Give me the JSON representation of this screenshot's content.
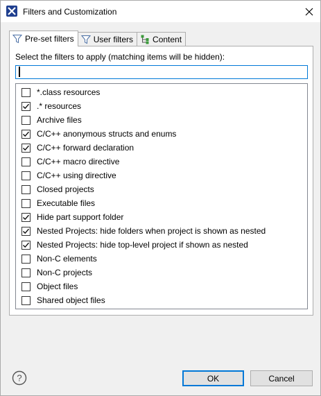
{
  "window": {
    "title": "Filters and Customization"
  },
  "tabs": [
    {
      "label": "Pre-set filters",
      "icon": "filter-icon",
      "active": true
    },
    {
      "label": "User filters",
      "icon": "filter-icon",
      "active": false
    },
    {
      "label": "Content",
      "icon": "tree-icon",
      "active": false
    }
  ],
  "panel": {
    "instruction": "Select the filters to apply (matching items will be hidden):",
    "filter_value": "",
    "items": [
      {
        "label": "*.class resources",
        "checked": false
      },
      {
        "label": ".* resources",
        "checked": true
      },
      {
        "label": "Archive files",
        "checked": false
      },
      {
        "label": "C/C++ anonymous structs and enums",
        "checked": true
      },
      {
        "label": "C/C++ forward declaration",
        "checked": true
      },
      {
        "label": "C/C++ macro directive",
        "checked": false
      },
      {
        "label": "C/C++ using directive",
        "checked": false
      },
      {
        "label": "Closed projects",
        "checked": false
      },
      {
        "label": "Executable files",
        "checked": false
      },
      {
        "label": "Hide part support folder",
        "checked": true
      },
      {
        "label": "Nested Projects: hide folders when project is shown as nested",
        "checked": true
      },
      {
        "label": "Nested Projects: hide top-level project if shown as nested",
        "checked": true
      },
      {
        "label": "Non-C elements",
        "checked": false
      },
      {
        "label": "Non-C projects",
        "checked": false
      },
      {
        "label": "Object files",
        "checked": false
      },
      {
        "label": "Shared object files",
        "checked": false
      }
    ]
  },
  "buttons": {
    "ok": "OK",
    "cancel": "Cancel"
  },
  "colors": {
    "focus": "#0078d7",
    "app_icon": "#1f3f8f"
  }
}
